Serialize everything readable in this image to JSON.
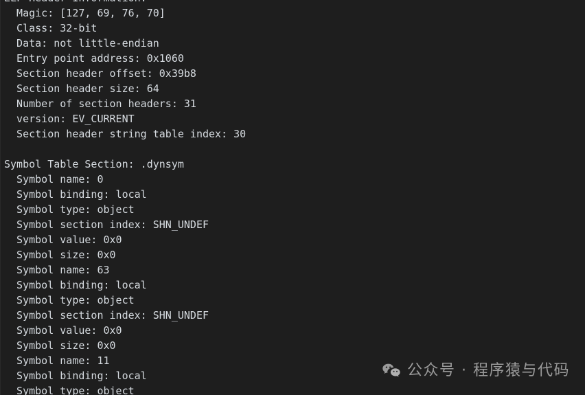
{
  "terminal": {
    "background_color": "#1e1e1e",
    "text_color": "#d6dbe0",
    "lines": [
      {
        "id": "line-clipped-top",
        "text": "ELF Header Information:",
        "indent": 0,
        "clipped": true
      },
      {
        "id": "line-magic",
        "text": "  Magic: [127, 69, 76, 70]",
        "indent": 2
      },
      {
        "id": "line-class",
        "text": "  Class: 32-bit",
        "indent": 2
      },
      {
        "id": "line-data",
        "text": "  Data: not little-endian",
        "indent": 2
      },
      {
        "id": "line-entry-point",
        "text": "  Entry point address: 0x1060",
        "indent": 2
      },
      {
        "id": "line-sh-offset",
        "text": "  Section header offset: 0x39b8",
        "indent": 2
      },
      {
        "id": "line-sh-size",
        "text": "  Section header size: 64",
        "indent": 2
      },
      {
        "id": "line-sh-count",
        "text": "  Number of section headers: 31",
        "indent": 2
      },
      {
        "id": "line-version",
        "text": "  version: EV_CURRENT",
        "indent": 2
      },
      {
        "id": "line-shstrndx",
        "text": "  Section header string table index: 30",
        "indent": 2
      },
      {
        "id": "line-blank-1",
        "text": "",
        "indent": 0,
        "blank": true
      },
      {
        "id": "line-symtab-section",
        "text": "Symbol Table Section: .dynsym",
        "indent": 0
      },
      {
        "id": "line-sym0-name",
        "text": "  Symbol name: 0",
        "indent": 2
      },
      {
        "id": "line-sym0-binding",
        "text": "  Symbol binding: local",
        "indent": 2
      },
      {
        "id": "line-sym0-type",
        "text": "  Symbol type: object",
        "indent": 2
      },
      {
        "id": "line-sym0-section-index",
        "text": "  Symbol section index: SHN_UNDEF",
        "indent": 2
      },
      {
        "id": "line-sym0-value",
        "text": "  Symbol value: 0x0",
        "indent": 2
      },
      {
        "id": "line-sym0-size",
        "text": "  Symbol size: 0x0",
        "indent": 2
      },
      {
        "id": "line-sym1-name",
        "text": "  Symbol name: 63",
        "indent": 2
      },
      {
        "id": "line-sym1-binding",
        "text": "  Symbol binding: local",
        "indent": 2
      },
      {
        "id": "line-sym1-type",
        "text": "  Symbol type: object",
        "indent": 2
      },
      {
        "id": "line-sym1-section-index",
        "text": "  Symbol section index: SHN_UNDEF",
        "indent": 2
      },
      {
        "id": "line-sym1-value",
        "text": "  Symbol value: 0x0",
        "indent": 2
      },
      {
        "id": "line-sym1-size",
        "text": "  Symbol size: 0x0",
        "indent": 2
      },
      {
        "id": "line-sym2-name",
        "text": "  Symbol name: 11",
        "indent": 2
      },
      {
        "id": "line-sym2-binding",
        "text": "  Symbol binding: local",
        "indent": 2
      },
      {
        "id": "line-sym2-type",
        "text": "  Symbol type: object",
        "indent": 2
      }
    ]
  },
  "watermark": {
    "icon": "wechat-icon",
    "text": "公众号 · 程序猿与代码",
    "color": "#9a9a9a"
  }
}
